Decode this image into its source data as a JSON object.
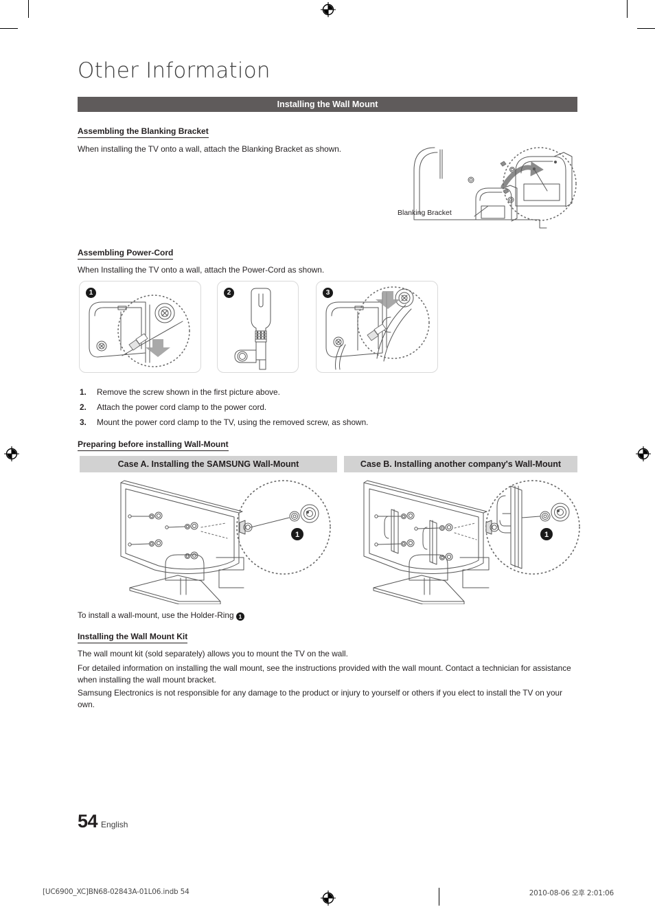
{
  "document": {
    "chapter_title": "Other Information",
    "section_band": "Installing the Wall Mount",
    "page_number": "54",
    "language": "English"
  },
  "blanking_bracket": {
    "heading": "Assembling the Blanking Bracket",
    "intro": "When installing the TV onto a wall, attach the Blanking Bracket as shown.",
    "figure_caption": "Blanking Bracket"
  },
  "power_cord": {
    "heading": "Assembling Power-Cord",
    "intro": "When Installing the TV onto a wall, attach the Power-Cord as shown.",
    "panels": [
      {
        "badge": "1",
        "name": "remove-screw-panel"
      },
      {
        "badge": "2",
        "name": "power-cord-clamp-panel"
      },
      {
        "badge": "3",
        "name": "mount-clamp-panel"
      }
    ],
    "steps": [
      {
        "num": "1.",
        "text": "Remove the screw shown in the first picture above."
      },
      {
        "num": "2.",
        "text": "Attach the power cord clamp to the power cord."
      },
      {
        "num": "3.",
        "text": "Mount the power cord clamp to the TV, using the removed screw, as shown."
      }
    ]
  },
  "preparing": {
    "heading": "Preparing before installing Wall-Mount",
    "case_a": "Case A. Installing the SAMSUNG Wall-Mount",
    "case_b": "Case B. Installing another company's Wall-Mount",
    "callout_badge": "1",
    "holder_ring_note_before": "To install a wall-mount, use the Holder-Ring ",
    "holder_ring_note_after": ""
  },
  "wall_mount_kit": {
    "heading": "Installing the Wall Mount Kit",
    "paragraphs": [
      "The wall mount kit (sold separately) allows you to mount the TV on the wall.",
      "For detailed information on installing the wall mount, see the instructions provided with the wall mount. Contact a technician for assistance when installing the wall mount bracket.",
      "Samsung Electronics is not responsible for any damage to the product or injury to yourself or others if you elect to install the TV on your own."
    ]
  },
  "print_footer": {
    "left": "[UC6900_XC]BN68-02843A-01L06.indb   54",
    "right": "2010-08-06   오후 2:01:06"
  },
  "colors": {
    "band_bg": "#5f5b5b",
    "case_bar_bg": "#d2d2d2",
    "text": "#231f20",
    "line_art": "#4d4d4d"
  }
}
